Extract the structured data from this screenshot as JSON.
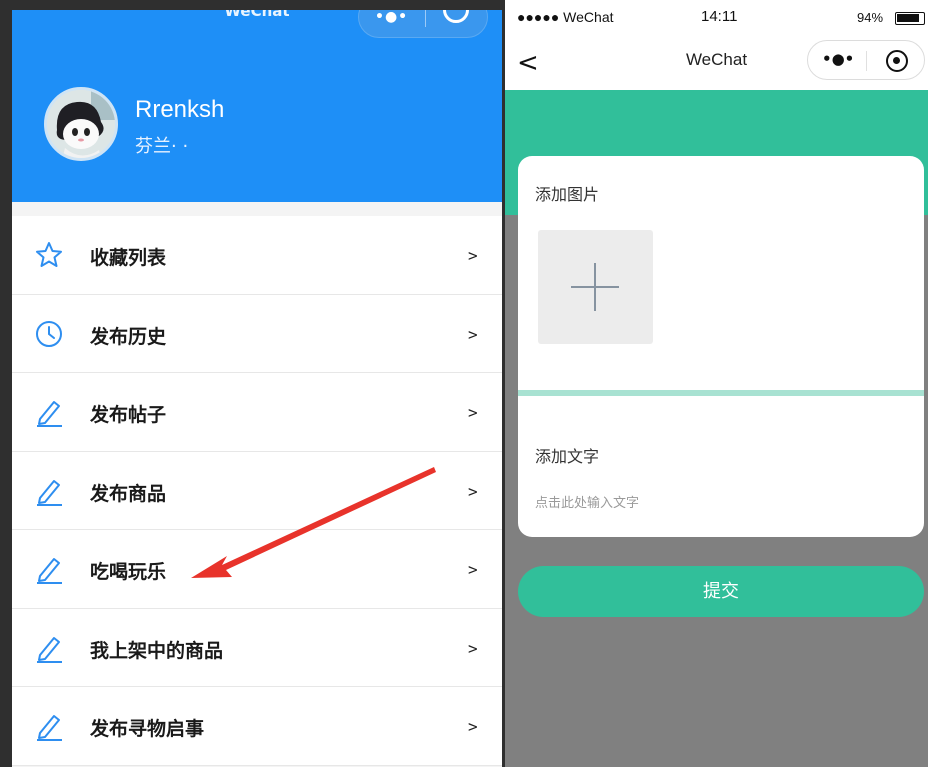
{
  "left_screen": {
    "title": "WeChat",
    "user": {
      "name": "Rrenksh",
      "subtitle": "芬兰· ·"
    },
    "menu": [
      {
        "label": "收藏列表",
        "icon": "star-icon",
        "arrow": ">"
      },
      {
        "label": "发布历史",
        "icon": "clock-icon",
        "arrow": ">"
      },
      {
        "label": "发布帖子",
        "icon": "pencil-icon",
        "arrow": ">"
      },
      {
        "label": "发布商品",
        "icon": "pencil-icon",
        "arrow": ">"
      },
      {
        "label": "吃喝玩乐",
        "icon": "pencil-icon",
        "arrow": ">"
      },
      {
        "label": "我上架中的商品",
        "icon": "pencil-icon",
        "arrow": ">"
      },
      {
        "label": "发布寻物启事",
        "icon": "pencil-icon",
        "arrow": ">"
      }
    ],
    "colors": {
      "header": "#1e8ff7",
      "icon": "#2e8ef0",
      "annotation_arrow": "#e8332b"
    }
  },
  "right_screen": {
    "status_bar": {
      "carrier": "●●●●● WeChat",
      "time": "14:11",
      "battery": "94%"
    },
    "nav": {
      "back": "<",
      "title": "WeChat",
      "more": "•●•"
    },
    "card": {
      "image_label": "添加图片",
      "text_label": "添加文字",
      "text_placeholder": "点击此处输入文字"
    },
    "submit_label": "提交",
    "colors": {
      "accent": "#31bf9a",
      "background": "#808080"
    }
  }
}
